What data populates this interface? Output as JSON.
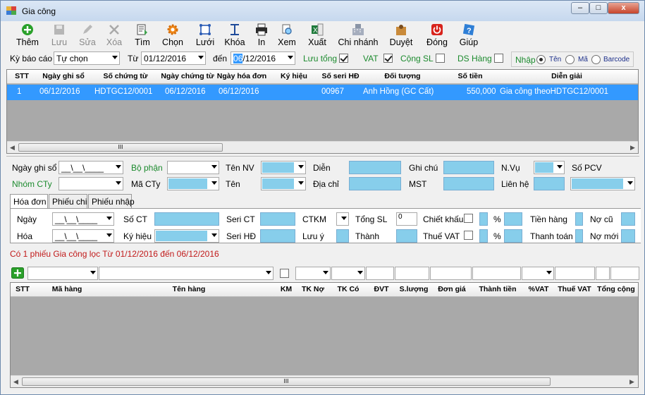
{
  "window": {
    "title": "Gia công",
    "min_label": "–",
    "max_label": "□",
    "close_label": "x"
  },
  "toolbar": [
    {
      "label": "Thêm",
      "icon": "plus-circle-icon",
      "enabled": true
    },
    {
      "label": "Lưu",
      "icon": "save-icon",
      "enabled": false
    },
    {
      "label": "Sửa",
      "icon": "pencil-icon",
      "enabled": false
    },
    {
      "label": "Xóa",
      "icon": "delete-icon",
      "enabled": false
    },
    {
      "label": "Tìm",
      "icon": "find-icon",
      "enabled": true
    },
    {
      "label": "Chọn",
      "icon": "gear-icon",
      "enabled": true
    },
    {
      "label": "Lưới",
      "icon": "grid-icon",
      "enabled": true
    },
    {
      "label": "Khóa",
      "icon": "lock-icon",
      "enabled": true
    },
    {
      "label": "In",
      "icon": "printer-icon",
      "enabled": true
    },
    {
      "label": "Xem",
      "icon": "preview-icon",
      "enabled": true
    },
    {
      "label": "Xuất",
      "icon": "export-icon",
      "enabled": true
    },
    {
      "label": "Chi nhánh",
      "icon": "building-icon",
      "enabled": true
    },
    {
      "label": "Duyệt",
      "icon": "approve-icon",
      "enabled": true
    },
    {
      "label": "Đóng",
      "icon": "power-icon",
      "enabled": true
    },
    {
      "label": "Giúp",
      "icon": "help-icon",
      "enabled": true
    }
  ],
  "filter": {
    "ky_bao_cao_label": "Kỳ báo cáo",
    "ky_bao_cao_value": "Tự chọn",
    "tu_label": "Từ",
    "tu_value": "01/12/2016",
    "den_label": "đến",
    "den_value_sel": "06",
    "den_value_rest": "/12/2016",
    "luu_tong_label": "Lưu tổng",
    "luu_tong": true,
    "vat_label": "VAT",
    "vat": true,
    "cong_sl_label": "Cộng SL",
    "cong_sl": false,
    "ds_hang_label": "DS Hàng",
    "ds_hang": false,
    "nhap_label": "Nhập",
    "radio_ten": "Tên",
    "radio_ma": "Mã",
    "radio_barcode": "Barcode",
    "selected_radio": "Tên"
  },
  "main_grid": {
    "columns": [
      "STT",
      "Ngày ghi sổ",
      "Số chứng từ",
      "Ngày chứng từ",
      "Ngày hóa đơn",
      "Ký hiệu",
      "Số seri HĐ",
      "Đối tượng",
      "Số tiền",
      "Diễn giải"
    ],
    "rows": [
      {
        "stt": "1",
        "ngay_ghi_so": "06/12/2016",
        "so_chung_tu": "HDTGC12/0001",
        "ngay_chung_tu": "06/12/2016",
        "ngay_hoa_don": "06/12/2016",
        "ky_hieu": "",
        "so_seri": "00967",
        "doi_tuong": "Anh Hồng (GC Cất)",
        "so_tien": "550,000",
        "dien_giai": "Gia công theoHDTGC12/0001"
      }
    ],
    "scroll_grip": "III"
  },
  "form": {
    "ngay_ghi_so_label": "Ngày ghi sổ",
    "ngay_ghi_so_value": "__\\__\\____",
    "bo_phan_label": "Bộ phận",
    "ten_nv_label": "Tên NV",
    "dien_label": "Diễn",
    "ghi_chu_label": "Ghi chú",
    "nvu_label": "N.Vụ",
    "so_pcv_label": "Số PCV",
    "nhom_cty_label": "Nhóm CTy",
    "ma_cty_label": "Mã CTy",
    "ten_label": "Tên",
    "dia_chi_label": "Địa chỉ",
    "mst_label": "MST",
    "lien_he_label": "Liên hệ"
  },
  "tabs": [
    "Hóa đơn",
    "Phiếu chi",
    "Phiếu nhập"
  ],
  "hoadon": {
    "ngay_label": "Ngày",
    "hoa_label": "Hóa",
    "date_value": "__\\__\\____",
    "so_ct_label": "Số CT",
    "ky_hieu_label": "Ký hiệu",
    "seri_ct_label": "Seri CT",
    "seri_hd_label": "Seri HĐ",
    "ctkm_label": "CTKM",
    "luu_y_label": "Lưu ý",
    "tong_sl_label": "Tổng SL",
    "tong_sl_value": "0",
    "thanh_label": "Thành",
    "chiet_khau_label": "Chiết khấu",
    "thue_vat_label": "Thuế VAT",
    "pct": "%",
    "tien_hang_label": "Tiền hàng",
    "thanh_toan_label": "Thanh toán",
    "no_cu_label": "Nợ cũ",
    "no_moi_label": "Nợ mới"
  },
  "status": "Có 1 phiếu Gia công lọc Từ 01/12/2016 đến 06/12/2016",
  "detail_grid": {
    "columns": [
      "STT",
      "Mã hàng",
      "Tên hàng",
      "KM",
      "TK Nợ",
      "TK Có",
      "ĐVT",
      "S.lượng",
      "Đơn giá",
      "Thành tiền",
      "%VAT",
      "Thuế VAT",
      "Tổng cộng"
    ],
    "scroll_grip": "III"
  },
  "colors": {
    "selection": "#3399ff",
    "field_cyan": "#87ceeb",
    "green": "#1b8a2d",
    "red": "#c11a1a"
  }
}
